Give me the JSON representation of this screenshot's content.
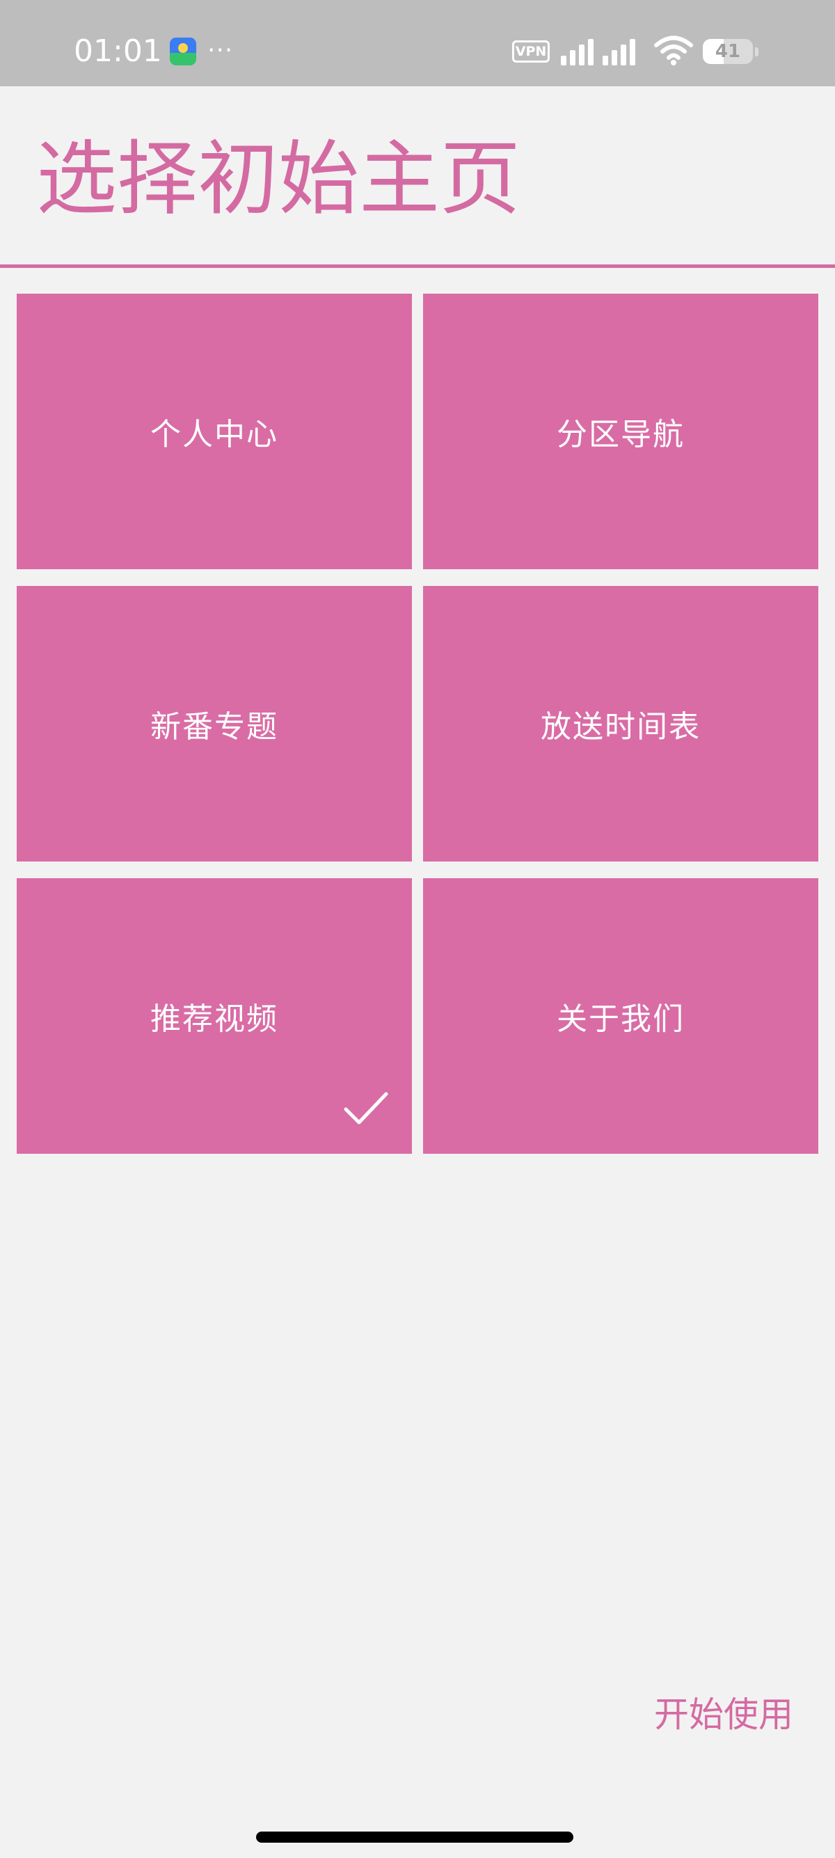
{
  "status_bar": {
    "time": "01:01",
    "more": "···",
    "vpn_label": "VPN",
    "battery_level": "41",
    "battery_fraction": 0.41,
    "app_icon": "gallery-app-icon",
    "signal_icon": "cellular-signal-icon",
    "wifi_icon": "wifi-icon"
  },
  "page": {
    "title": "选择初始主页",
    "start_button_label": "开始使用"
  },
  "tiles": [
    {
      "label": "个人中心",
      "selected": false
    },
    {
      "label": "分区导航",
      "selected": false
    },
    {
      "label": "新番专题",
      "selected": false
    },
    {
      "label": "放送时间表",
      "selected": false
    },
    {
      "label": "推荐视频",
      "selected": true
    },
    {
      "label": "关于我们",
      "selected": false
    }
  ],
  "colors": {
    "accent": "#d46aa2",
    "tile": "#d96ca5",
    "background": "#f2f2f2",
    "status_bar": "#bdbdbd"
  },
  "icons": {
    "selected_tile": "checkmark-icon"
  }
}
